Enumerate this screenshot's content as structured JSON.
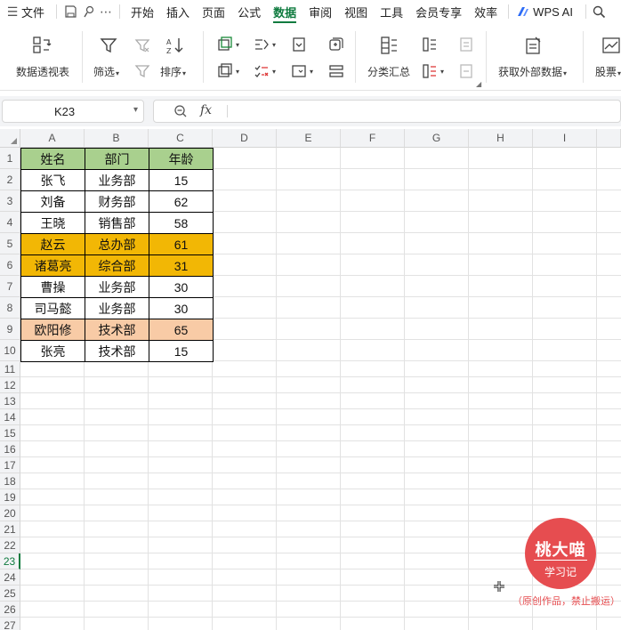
{
  "menu": {
    "file_label": "文件",
    "tabs": [
      "开始",
      "插入",
      "页面",
      "公式",
      "数据",
      "审阅",
      "视图",
      "工具",
      "会员专享",
      "效率"
    ],
    "active_tab": "数据",
    "ai_label": "WPS AI"
  },
  "ribbon": {
    "pivot_label": "数据透视表",
    "filter_label": "筛选",
    "sort_label": "排序",
    "subtotal_label": "分类汇总",
    "external_label": "获取外部数据",
    "stock_label": "股票"
  },
  "formula_bar": {
    "name_box": "K23",
    "fx_label": "fx",
    "content": ""
  },
  "sheet": {
    "columns": [
      "A",
      "B",
      "C",
      "D",
      "E",
      "F",
      "G",
      "H",
      "I"
    ],
    "rows": [
      "1",
      "2",
      "3",
      "4",
      "5",
      "6",
      "7",
      "8",
      "9",
      "10",
      "11",
      "12",
      "13",
      "14",
      "15",
      "16",
      "17",
      "18",
      "19",
      "20",
      "21",
      "22",
      "23",
      "24",
      "25",
      "26",
      "27"
    ],
    "selected_row": "23",
    "table": [
      [
        "姓名",
        "部门",
        "年龄"
      ],
      [
        "张飞",
        "业务部",
        "15"
      ],
      [
        "刘备",
        "财务部",
        "62"
      ],
      [
        "王晓",
        "销售部",
        "58"
      ],
      [
        "赵云",
        "总办部",
        "61"
      ],
      [
        "诸葛亮",
        "综合部",
        "31"
      ],
      [
        "曹操",
        "业务部",
        "30"
      ],
      [
        "司马懿",
        "业务部",
        "30"
      ],
      [
        "欧阳修",
        "技术部",
        "65"
      ],
      [
        "张亮",
        "技术部",
        "15"
      ]
    ],
    "colors": {
      "header_fill": "#a9d08e",
      "highlight_orange": "#f2b705",
      "highlight_peach": "#f8cba6",
      "accent_green": "#0f7b3f"
    },
    "row_fills": [
      "header",
      "",
      "",
      "",
      "orange",
      "orange",
      "",
      "",
      "peach",
      ""
    ]
  },
  "watermark": {
    "title": "桃大喵",
    "subtitle": "学习记",
    "note": "（原创作品，禁止搬运）"
  }
}
